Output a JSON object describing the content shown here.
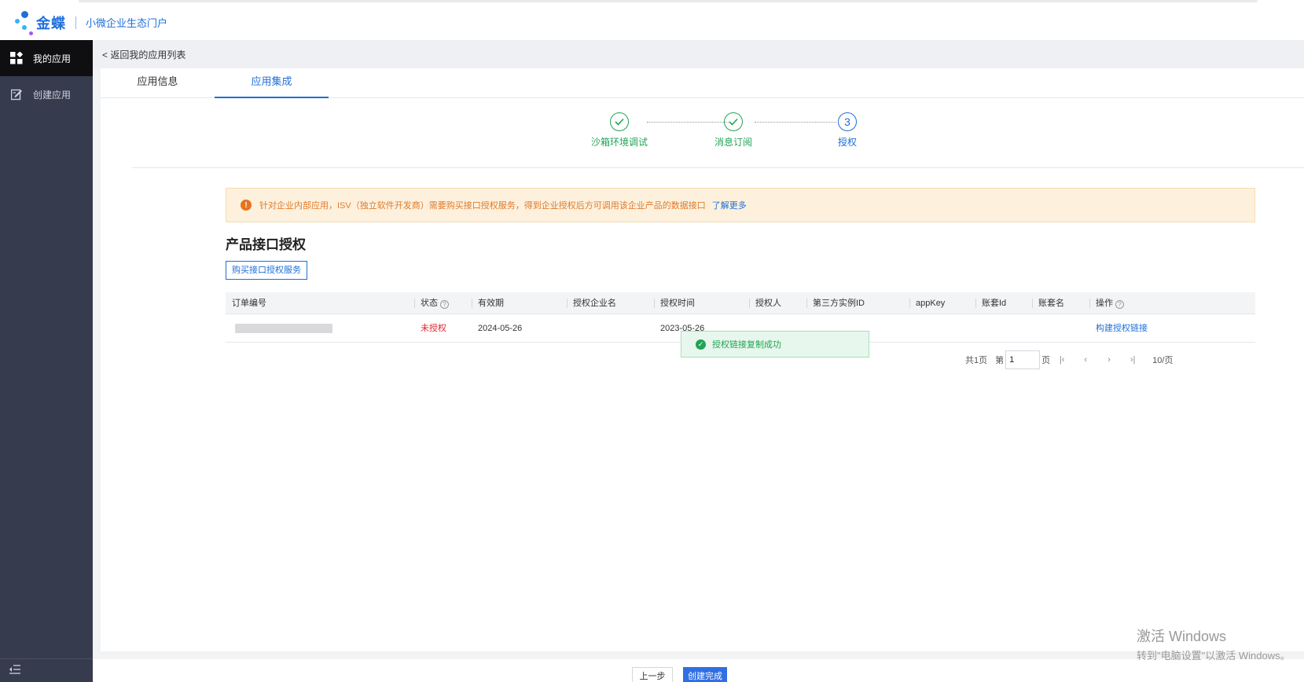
{
  "header": {
    "brand": "金蝶",
    "subtitle": "小微企业生态门户"
  },
  "sidebar": {
    "items": [
      {
        "label": "我的应用",
        "icon": "grid-icon"
      },
      {
        "label": "创建应用",
        "icon": "edit-icon"
      }
    ]
  },
  "breadcrumb": {
    "back_label": "< 返回我的应用列表"
  },
  "tabs": [
    {
      "label": "应用信息"
    },
    {
      "label": "应用集成"
    }
  ],
  "steps": [
    {
      "label": "沙箱环境调试",
      "state": "done"
    },
    {
      "label": "消息订阅",
      "state": "done"
    },
    {
      "label": "授权",
      "state": "current",
      "number": "3"
    }
  ],
  "alert": {
    "text": "针对企业内部应用，ISV（独立软件开发商）需要购买接口授权服务，得到企业授权后方可调用该企业产品的数据接口",
    "link": "了解更多"
  },
  "section": {
    "title": "产品接口授权",
    "buy_button": "购买接口授权服务"
  },
  "table": {
    "columns": [
      "订单编号",
      "状态",
      "有效期",
      "授权企业名",
      "授权时间",
      "授权人",
      "第三方实例ID",
      "appKey",
      "账套Id",
      "账套名",
      "操作"
    ],
    "rows": [
      {
        "order_no": "",
        "status": "未授权",
        "valid_until": "2024-05-26",
        "company": "",
        "auth_time": "2023-05-26",
        "authorizer": "",
        "instance_id": "",
        "app_key": "",
        "account_id": "",
        "account_name": "",
        "action": "构建授权链接"
      }
    ]
  },
  "toast": {
    "text": "授权链接复制成功"
  },
  "pagination": {
    "total": "共1页",
    "page_prefix": "第",
    "page_value": "1",
    "page_suffix": "页",
    "page_size": "10/页"
  },
  "footer": {
    "prev_label": "上一步",
    "done_label": "创建完成"
  },
  "watermark": {
    "line1": "激活 Windows",
    "line2": "转到\"电脑设置\"以激活 Windows。"
  },
  "colors": {
    "primary": "#1e6fd9",
    "success": "#22a355",
    "danger": "#e5242b",
    "warning": "#e07b2b",
    "sidebar": "#363b4e"
  }
}
